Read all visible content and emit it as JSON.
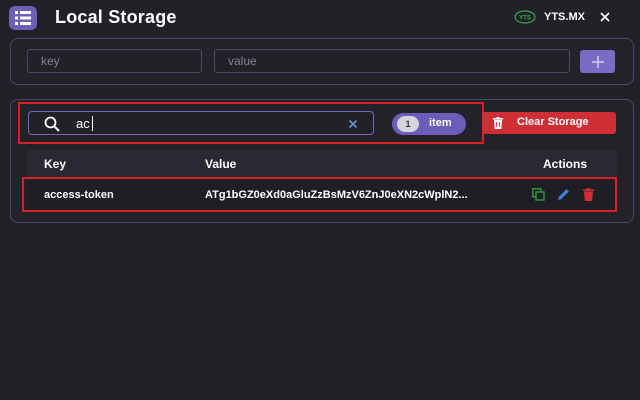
{
  "header": {
    "title": "Local Storage",
    "site_name": "YTS.MX",
    "site_logo_text": "YTS"
  },
  "add_form": {
    "key_placeholder": "key",
    "value_placeholder": "value",
    "add_icon": "plus-icon"
  },
  "search": {
    "value": "ac",
    "icon": "search-icon",
    "clear_icon": "close-icon"
  },
  "count": {
    "number": "1",
    "label": "item"
  },
  "clear_storage": {
    "label": "Clear Storage",
    "icon": "trash-icon"
  },
  "table": {
    "headers": [
      "Key",
      "Value",
      "Actions"
    ],
    "rows": [
      {
        "key": "access-token",
        "value": "ATg1bGZ0eXd0aGluZzBsMzV6ZnJ0eXN2cWplN2...",
        "actions": [
          "copy-icon",
          "edit-icon",
          "delete-icon"
        ]
      }
    ]
  },
  "colors": {
    "background": "#222128",
    "accent": "#6f5fb7",
    "danger": "#cf2f34",
    "copy": "#2e9a3a",
    "edit": "#3a7fd6",
    "highlight": "#d62227"
  }
}
